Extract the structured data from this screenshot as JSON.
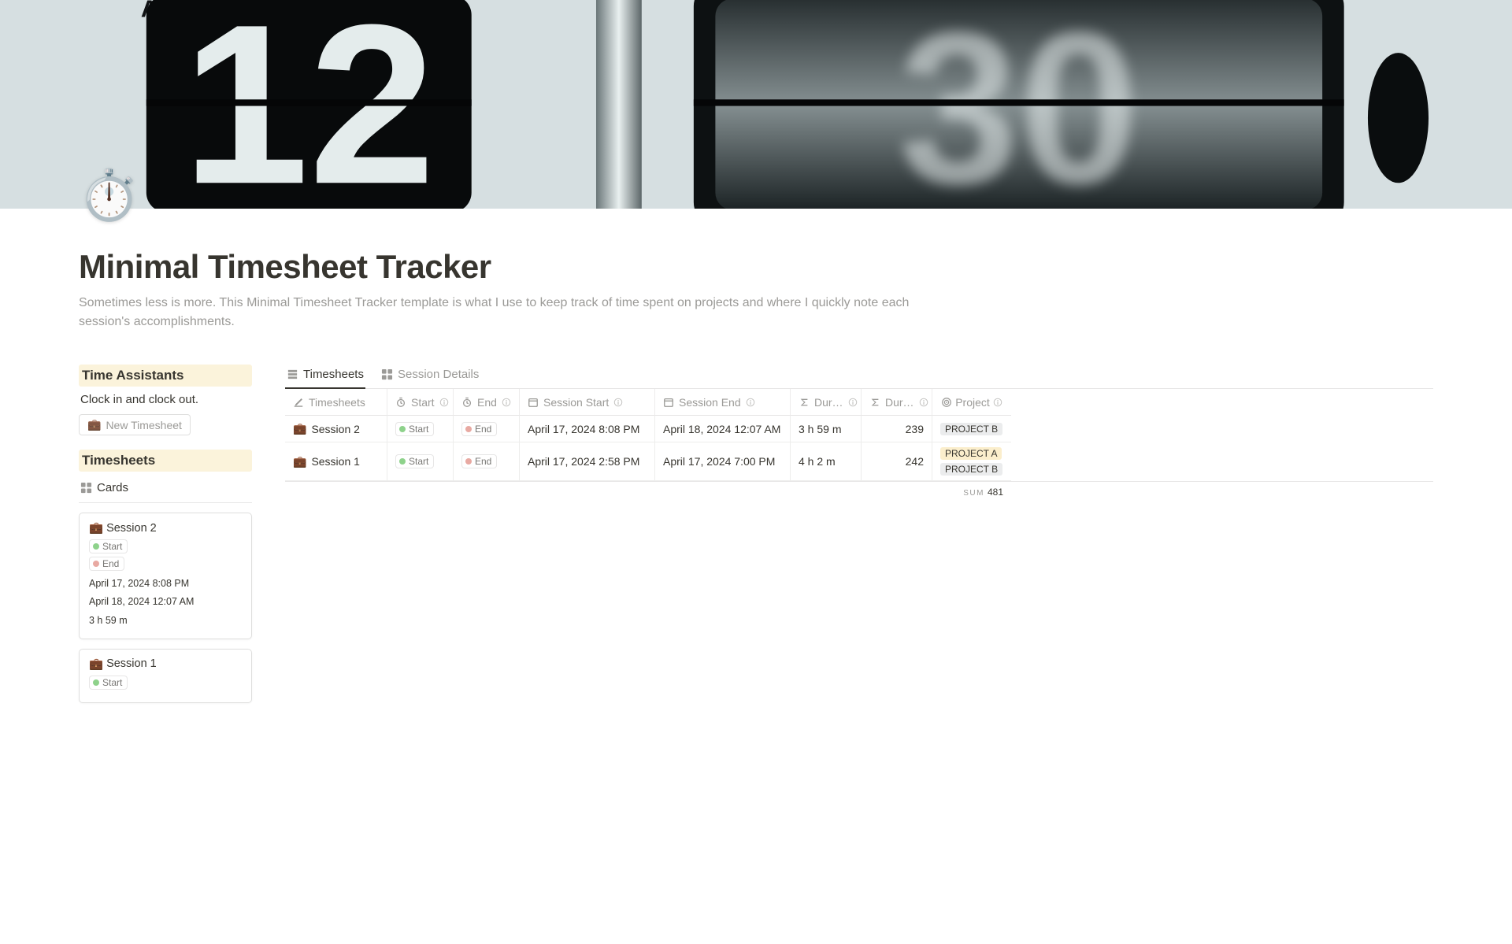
{
  "page": {
    "icon_emoji": "⏱️",
    "title": "Minimal Timesheet Tracker",
    "description": "Sometimes less is more. This Minimal Timesheet Tracker template is what I use to keep track of time spent on projects and where I quickly note each session's accomplishments."
  },
  "sidebar": {
    "section_assistants": "Time Assistants",
    "clock_text": "Clock in and clock out.",
    "new_button_emoji": "💼",
    "new_button_label": "New Timesheet",
    "section_timesheets": "Timesheets",
    "cards_view_label": "Cards"
  },
  "chips": {
    "start": "Start",
    "end": "End"
  },
  "cards": [
    {
      "emoji": "💼",
      "title": "Session 2",
      "start": "April 17, 2024 8:08 PM",
      "end": "April 18, 2024 12:07 AM",
      "duration": "3 h 59 m"
    },
    {
      "emoji": "💼",
      "title": "Session 1",
      "start": "",
      "end": "",
      "duration": ""
    }
  ],
  "tabs": {
    "timesheets": "Timesheets",
    "session_details": "Session Details"
  },
  "columns": {
    "timesheets": "Timesheets",
    "start": "Start",
    "end": "End",
    "session_start": "Session Start",
    "session_end": "Session End",
    "dur1": "Dur…",
    "dur2": "Dur…",
    "project": "Project"
  },
  "rows": [
    {
      "emoji": "💼",
      "title": "Session 2",
      "session_start": "April 17, 2024 8:08 PM",
      "session_end": "April 18, 2024 12:07 AM",
      "dur1": "3 h 59 m",
      "dur2": "239",
      "projects": [
        {
          "label": "PROJECT B",
          "color": "gray"
        }
      ]
    },
    {
      "emoji": "💼",
      "title": "Session 1",
      "session_start": "April 17, 2024 2:58 PM",
      "session_end": "April 17, 2024 7:00 PM",
      "dur1": "4 h 2 m",
      "dur2": "242",
      "projects": [
        {
          "label": "PROJECT A",
          "color": "yellow"
        },
        {
          "label": "PROJECT B",
          "color": "gray"
        }
      ]
    }
  ],
  "sum": {
    "label": "SUM",
    "value": "481"
  }
}
